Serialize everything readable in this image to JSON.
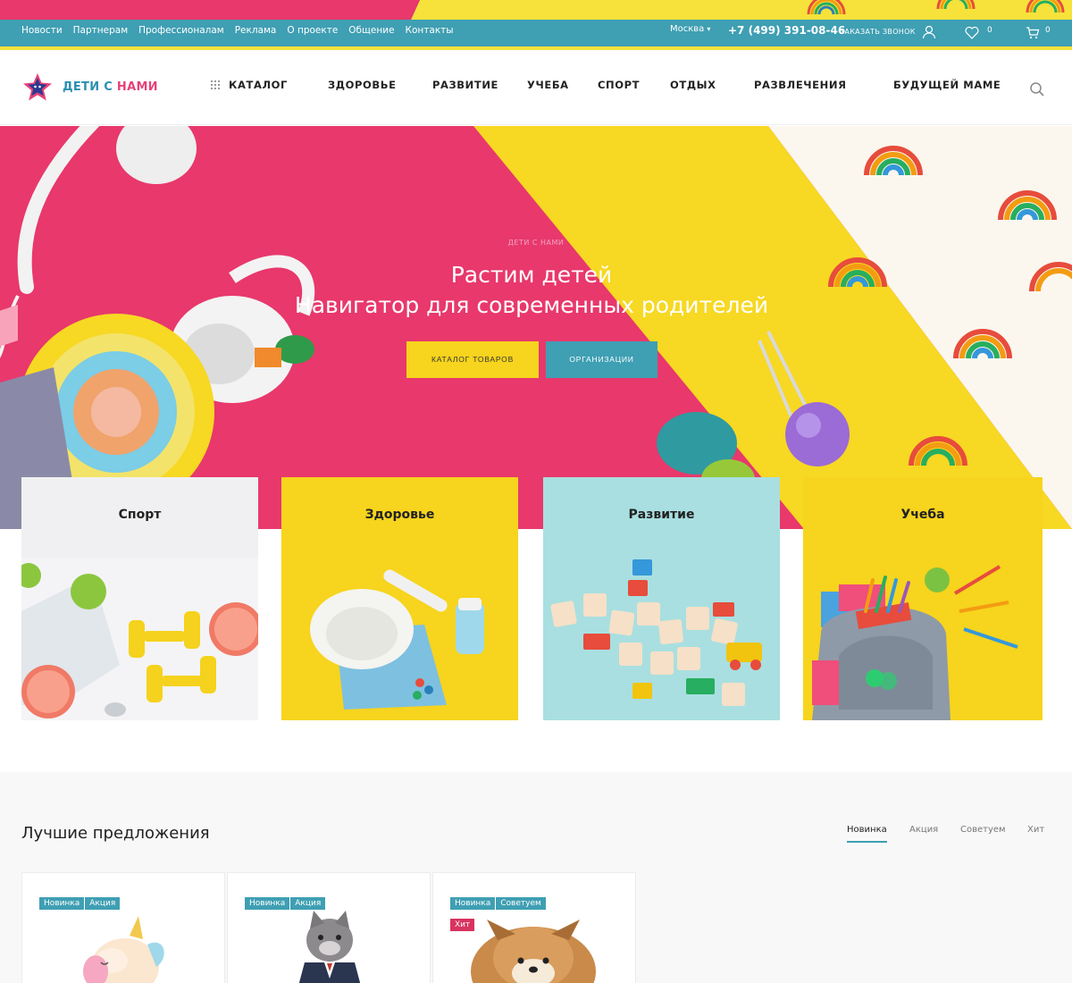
{
  "topbar": {
    "links": [
      "Новости",
      "Партнерам",
      "Профессионалам",
      "Реклама",
      "О проекте",
      "Общение",
      "Контакты"
    ],
    "city": "Москва",
    "phone": "+7 (499) 391-08-46",
    "callback": "ЗАКАЗАТЬ ЗВОНОК",
    "favorites_count": "0",
    "cart_count": "0"
  },
  "header": {
    "logo_text_1": "ДЕТИ С ",
    "logo_text_2": "НАМИ",
    "nav": [
      "КАТАЛОГ",
      "ЗДОРОВЬЕ",
      "РАЗВИТИЕ",
      "УЧЕБА",
      "СПОРТ",
      "ОТДЫХ",
      "РАЗВЛЕЧЕНИЯ",
      "БУДУЩЕЙ МАМЕ"
    ]
  },
  "hero": {
    "kicker": "ДЕТИ С НАМИ",
    "title_line1": "Растим детей",
    "title_line2": "Навигатор для современных родителей",
    "button_catalog": "КАТАЛОГ ТОВАРОВ",
    "button_orgs": "ОРГАНИЗАЦИИ"
  },
  "categories": [
    "Спорт",
    "Здоровье",
    "Развитие",
    "Учеба"
  ],
  "offers": {
    "title": "Лучшие предложения",
    "tabs": [
      "Новинка",
      "Акция",
      "Советуем",
      "Хит"
    ],
    "products": [
      {
        "badges": [
          "Новинка",
          "Акция"
        ]
      },
      {
        "badges": [
          "Новинка",
          "Акция"
        ]
      },
      {
        "badges": [
          "Новинка",
          "Советуем",
          "Хит"
        ]
      }
    ]
  },
  "colors": {
    "brand_blue": "#3f9fb3",
    "brand_yellow": "#f7d41d",
    "brand_pink": "#e8386c",
    "hit_badge": "#d8335f"
  },
  "icons": [
    "user-icon",
    "heart-icon",
    "cart-icon",
    "grid-icon",
    "search-icon",
    "logo-star-icon"
  ]
}
